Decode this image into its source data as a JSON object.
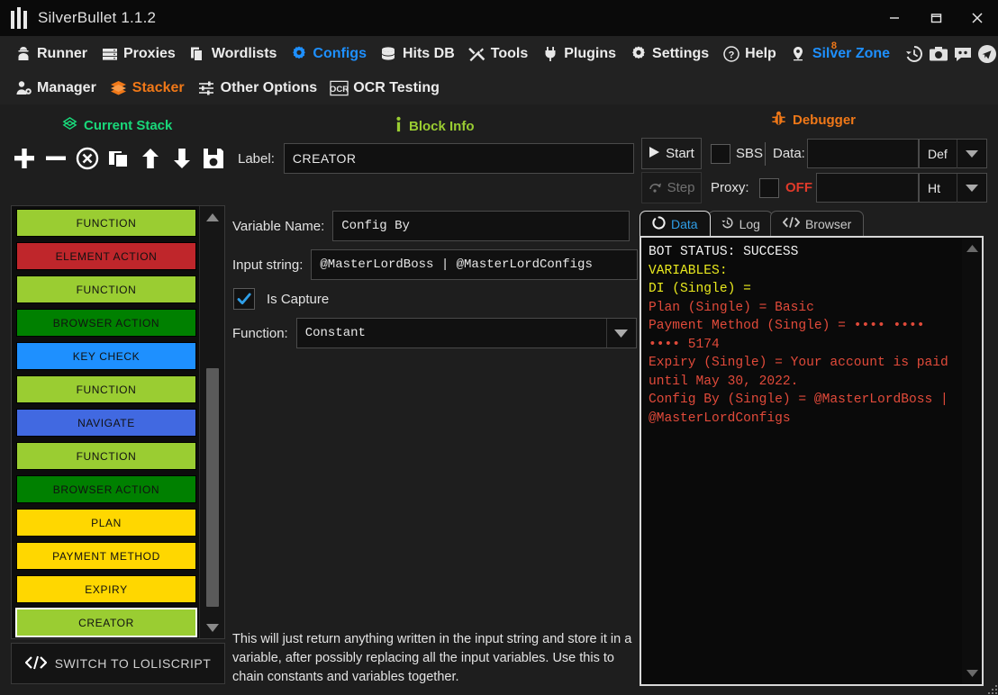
{
  "window": {
    "title": "SilverBullet 1.1.2",
    "minimize": "–",
    "maximize": "❐",
    "close": "✕"
  },
  "menu_row1": [
    {
      "label": "Runner",
      "icon": "runner-icon",
      "state": "normal"
    },
    {
      "label": "Proxies",
      "icon": "proxies-icon",
      "state": "normal"
    },
    {
      "label": "Wordlists",
      "icon": "wordlists-icon",
      "state": "normal"
    },
    {
      "label": "Configs",
      "icon": "configs-gear-icon",
      "state": "active-blue"
    },
    {
      "label": "Hits DB",
      "icon": "database-icon",
      "state": "normal"
    },
    {
      "label": "Tools",
      "icon": "tools-icon",
      "state": "normal"
    },
    {
      "label": "Plugins",
      "icon": "plug-icon",
      "state": "normal"
    },
    {
      "label": "Settings",
      "icon": "gear-icon",
      "state": "normal"
    },
    {
      "label": "Help",
      "icon": "question-circle-icon",
      "state": "normal"
    },
    {
      "label": "Silver Zone",
      "icon": "location-pin-icon",
      "state": "active-blue",
      "badge": "8"
    }
  ],
  "menu_row1_icons": [
    {
      "name": "history-icon"
    },
    {
      "name": "camera-icon"
    },
    {
      "name": "discord-icon"
    },
    {
      "name": "telegram-icon"
    }
  ],
  "menu_row2": [
    {
      "label": "Manager",
      "icon": "manager-icon",
      "state": "normal"
    },
    {
      "label": "Stacker",
      "icon": "stacker-layers-icon",
      "state": "active-orange"
    },
    {
      "label": "Other Options",
      "icon": "sliders-icon",
      "state": "normal"
    },
    {
      "label": "OCR Testing",
      "icon": "ocr-icon",
      "state": "normal"
    }
  ],
  "stack": {
    "header": "Current Stack",
    "header_icon": "diamond-layers-icon",
    "tools": [
      {
        "name": "add-block-button",
        "icon": "plus-icon"
      },
      {
        "name": "remove-block-button",
        "icon": "minus-icon"
      },
      {
        "name": "delete-all-blocks-button",
        "icon": "circle-x-icon"
      },
      {
        "name": "clone-block-button",
        "icon": "clone-icon"
      },
      {
        "name": "move-block-up-button",
        "icon": "arrow-up-icon"
      },
      {
        "name": "move-block-down-button",
        "icon": "arrow-down-icon"
      },
      {
        "name": "save-stack-button",
        "icon": "save-disk-icon"
      }
    ],
    "blocks": [
      {
        "label": "FUNCTION",
        "color": "#9acd32",
        "selected": false
      },
      {
        "label": "ELEMENT ACTION",
        "color": "#bf262b",
        "selected": false
      },
      {
        "label": "FUNCTION",
        "color": "#9acd32",
        "selected": false
      },
      {
        "label": "BROWSER ACTION",
        "color": "#008000",
        "selected": false
      },
      {
        "label": "KEY CHECK",
        "color": "#1e90ff",
        "selected": false
      },
      {
        "label": "FUNCTION",
        "color": "#9acd32",
        "selected": false
      },
      {
        "label": "NAVIGATE",
        "color": "#4169e1",
        "selected": false
      },
      {
        "label": "FUNCTION",
        "color": "#9acd32",
        "selected": false
      },
      {
        "label": "BROWSER ACTION",
        "color": "#008000",
        "selected": false
      },
      {
        "label": "PLAN",
        "color": "#ffd700",
        "selected": false
      },
      {
        "label": "PAYMENT METHOD",
        "color": "#ffd700",
        "selected": false
      },
      {
        "label": "EXPIRY",
        "color": "#ffd700",
        "selected": false
      },
      {
        "label": "CREATOR",
        "color": "#9acd32",
        "selected": true
      }
    ],
    "switch_button": "SWITCH TO LOLISCRIPT",
    "switch_icon": "code-icon"
  },
  "block_info": {
    "header": "Block Info",
    "header_icon": "info-icon",
    "label_label": "Label:",
    "label_value": "CREATOR",
    "variable_name_label": "Variable Name:",
    "variable_name_value": "Config By",
    "input_string_label": "Input string:",
    "input_string_value": "@MasterLordBoss  |  @MasterLordConfigs",
    "is_capture_label": "Is Capture",
    "is_capture_checked": true,
    "function_label": "Function:",
    "function_value": "Constant",
    "description": "This will just return anything written in the input string and store it in a variable, after possibly replacing all the input variables.\nUse this to chain constants and variables together."
  },
  "debugger": {
    "header": "Debugger",
    "header_icon": "bug-icon",
    "start_button": "Start",
    "start_icon": "play-icon",
    "step_button": "Step",
    "step_icon": "step-over-icon",
    "sbs_label": "SBS",
    "sbs_checked": false,
    "data_label": "Data:",
    "data_value": "",
    "data_type_value": "Def",
    "proxy_label": "Proxy:",
    "proxy_checked": false,
    "proxy_state": "OFF",
    "proxy_value": "",
    "proxy_type_value": "Ht",
    "tabs": [
      {
        "label": "Data",
        "icon": "data-circle-icon",
        "active": true
      },
      {
        "label": "Log",
        "icon": "history-clock-icon",
        "active": false
      },
      {
        "label": "Browser",
        "icon": "code-brackets-icon",
        "active": false
      }
    ],
    "output": [
      {
        "text": "BOT STATUS: SUCCESS",
        "color": "white"
      },
      {
        "text": "VARIABLES:",
        "color": "yellow"
      },
      {
        "text": "DI (Single) =",
        "color": "yellow"
      },
      {
        "text": "Plan (Single) = Basic",
        "color": "red"
      },
      {
        "text": "Payment Method (Single) = •••• •••• •••• 5174",
        "color": "red"
      },
      {
        "text": "Expiry (Single) = Your account is paid until May 30, 2022.",
        "color": "red"
      },
      {
        "text": "Config By (Single) = @MasterLordBoss | @MasterLordConfigs",
        "color": "red"
      }
    ]
  }
}
